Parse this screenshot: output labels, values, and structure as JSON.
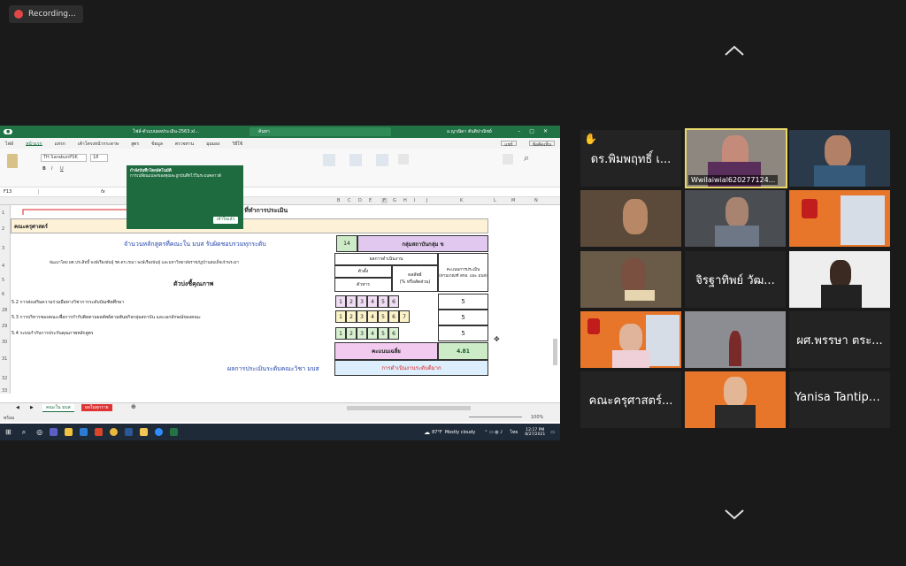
{
  "recording": {
    "label": "Recording..."
  },
  "excel": {
    "title": "ไฟล์-ตัวแบบผลประเมิน-2563.xl...",
    "search": "ค้นหา",
    "user": "อ.ญาณิดา ตันติปาณิชย์",
    "tabs": [
      "ไฟล์",
      "หน้าแรก",
      "แทรก",
      "เค้าโครงหน้ากระดาษ",
      "สูตร",
      "ข้อมูล",
      "ตรวจทาน",
      "มุมมอง",
      "วิธีใช้"
    ],
    "share_label": "แชร์",
    "comment_label": "ข้อคิดเห็น",
    "font": "TH SarabunPSK",
    "font_size": "18",
    "tooltip_title": "กำลังบันทึกโดยอัตโนมัติ",
    "tooltip_body": "การเปลี่ยนแปลงของคุณจะถูกบันทึกไว้ในระบบคลาวด์",
    "tooltip_btn": "เข้าใจแล้ว",
    "namebox": "F13",
    "fx": "fx",
    "cols": [
      "A",
      "B",
      "C",
      "D",
      "E",
      "F",
      "G",
      "H",
      "I",
      "J",
      "K",
      "L",
      "M",
      "N"
    ],
    "rows": [
      "1",
      "2",
      "3",
      "4",
      "5",
      "6",
      "28",
      "29",
      "30",
      "31",
      "32",
      "33"
    ],
    "sheet": {
      "r1": "ชื่อคณะใน มบส ที่ทำการประเมิน",
      "r2": "คณะครุศาสตร์",
      "r3_label": "จำนวนหลักสูตรที่คณะใน มบส รับผิดชอบรวมทุกระดับ",
      "r3_value": "14",
      "r3_group": "กลุ่มสถาบันกลุ่ม ข",
      "r4_dev": "พัฒนาโดย ผศ.ประสิทธิ์ พงษ์เรืองพันธุ์ รศ.ดร.เรณา พงษ์เรืองพันธุ์ และมหาวิทยาลัยราชภัฏบ้านสมเด็จเจ้าพระยา",
      "r4_result": "ผลการดำเนินงาน",
      "r4_score": "คะแนนการประเมิน",
      "r4_score2": "(ตามเกณฑ์ สกอ. และ มบส)",
      "r5_target": "ตัวตั้ง",
      "r5_result": "ผลลัพธ์",
      "r6_indicator": "ตัวบ่งชี้คุณภาพ",
      "r6_divisor": "ตัวหาร",
      "r6_pct": "(% หรือสัดส่วน)",
      "items": [
        {
          "label": "5.2 การส่งเสริมความร่วมมือทางวิชาการระดับบัณฑิตศึกษา",
          "nums": [
            "1",
            "2",
            "3",
            "4",
            "5",
            "6"
          ],
          "score": "5"
        },
        {
          "label": "5.3 การบริหารของคณะเพื่อการกำกับติดตามผลลัพธ์ตามพันธกิจกลุ่มสถาบัน และเอกลักษณ์ของคณะ",
          "nums": [
            "1",
            "2",
            "3",
            "4",
            "5",
            "6",
            "7"
          ],
          "score": "5"
        },
        {
          "label": "5.4 ระบบกำกับการประกันคุณภาพหลักสูตร",
          "nums": [
            "1",
            "2",
            "3",
            "4",
            "5",
            "6"
          ],
          "score": "5"
        }
      ],
      "avg_label": "คะแนนเฉลี่ย",
      "avg_value": "4.81",
      "eval_label": "ผลการประเมินระดับคณะวิชา มบส",
      "eval_value": "การดำเนินงานระดับดีมาก"
    },
    "sheet_tabs": [
      "คณะใน มบส",
      "ผลในทุกราย"
    ],
    "status": "พร้อม",
    "zoom": "100%",
    "weather_temp": "87°F",
    "weather_desc": "Mostly cloudy",
    "clock_time": "12:17 PM",
    "clock_date": "8/27/2021",
    "lang": "ไทย"
  },
  "gallery": [
    {
      "name": "ดร.พิมพฤทธิ์ เ...",
      "video": false,
      "hand": true
    },
    {
      "name": "Wwilaiwial620277124...",
      "video": true,
      "label": true,
      "active": true
    },
    {
      "name": "",
      "video": true
    },
    {
      "name": "",
      "video": true
    },
    {
      "name": "",
      "video": true
    },
    {
      "name": "",
      "video": true,
      "orange": true
    },
    {
      "name": "",
      "video": true
    },
    {
      "name": "จิรฐาทิพย์ วัฒ...",
      "video": false
    },
    {
      "name": "",
      "video": true
    },
    {
      "name": "",
      "video": true,
      "orange": true
    },
    {
      "name": "",
      "video": true
    },
    {
      "name": "ผศ.พรรษา ตระ...",
      "video": false
    },
    {
      "name": "คณะครุศาสตร์...",
      "video": false
    },
    {
      "name": "",
      "video": true,
      "orange": true
    },
    {
      "name": "Yanisa Tantipa...",
      "video": false
    }
  ],
  "colors": {
    "excel_green": "#217346",
    "recording_red": "#e04848",
    "highlight": "#e8d86a"
  }
}
